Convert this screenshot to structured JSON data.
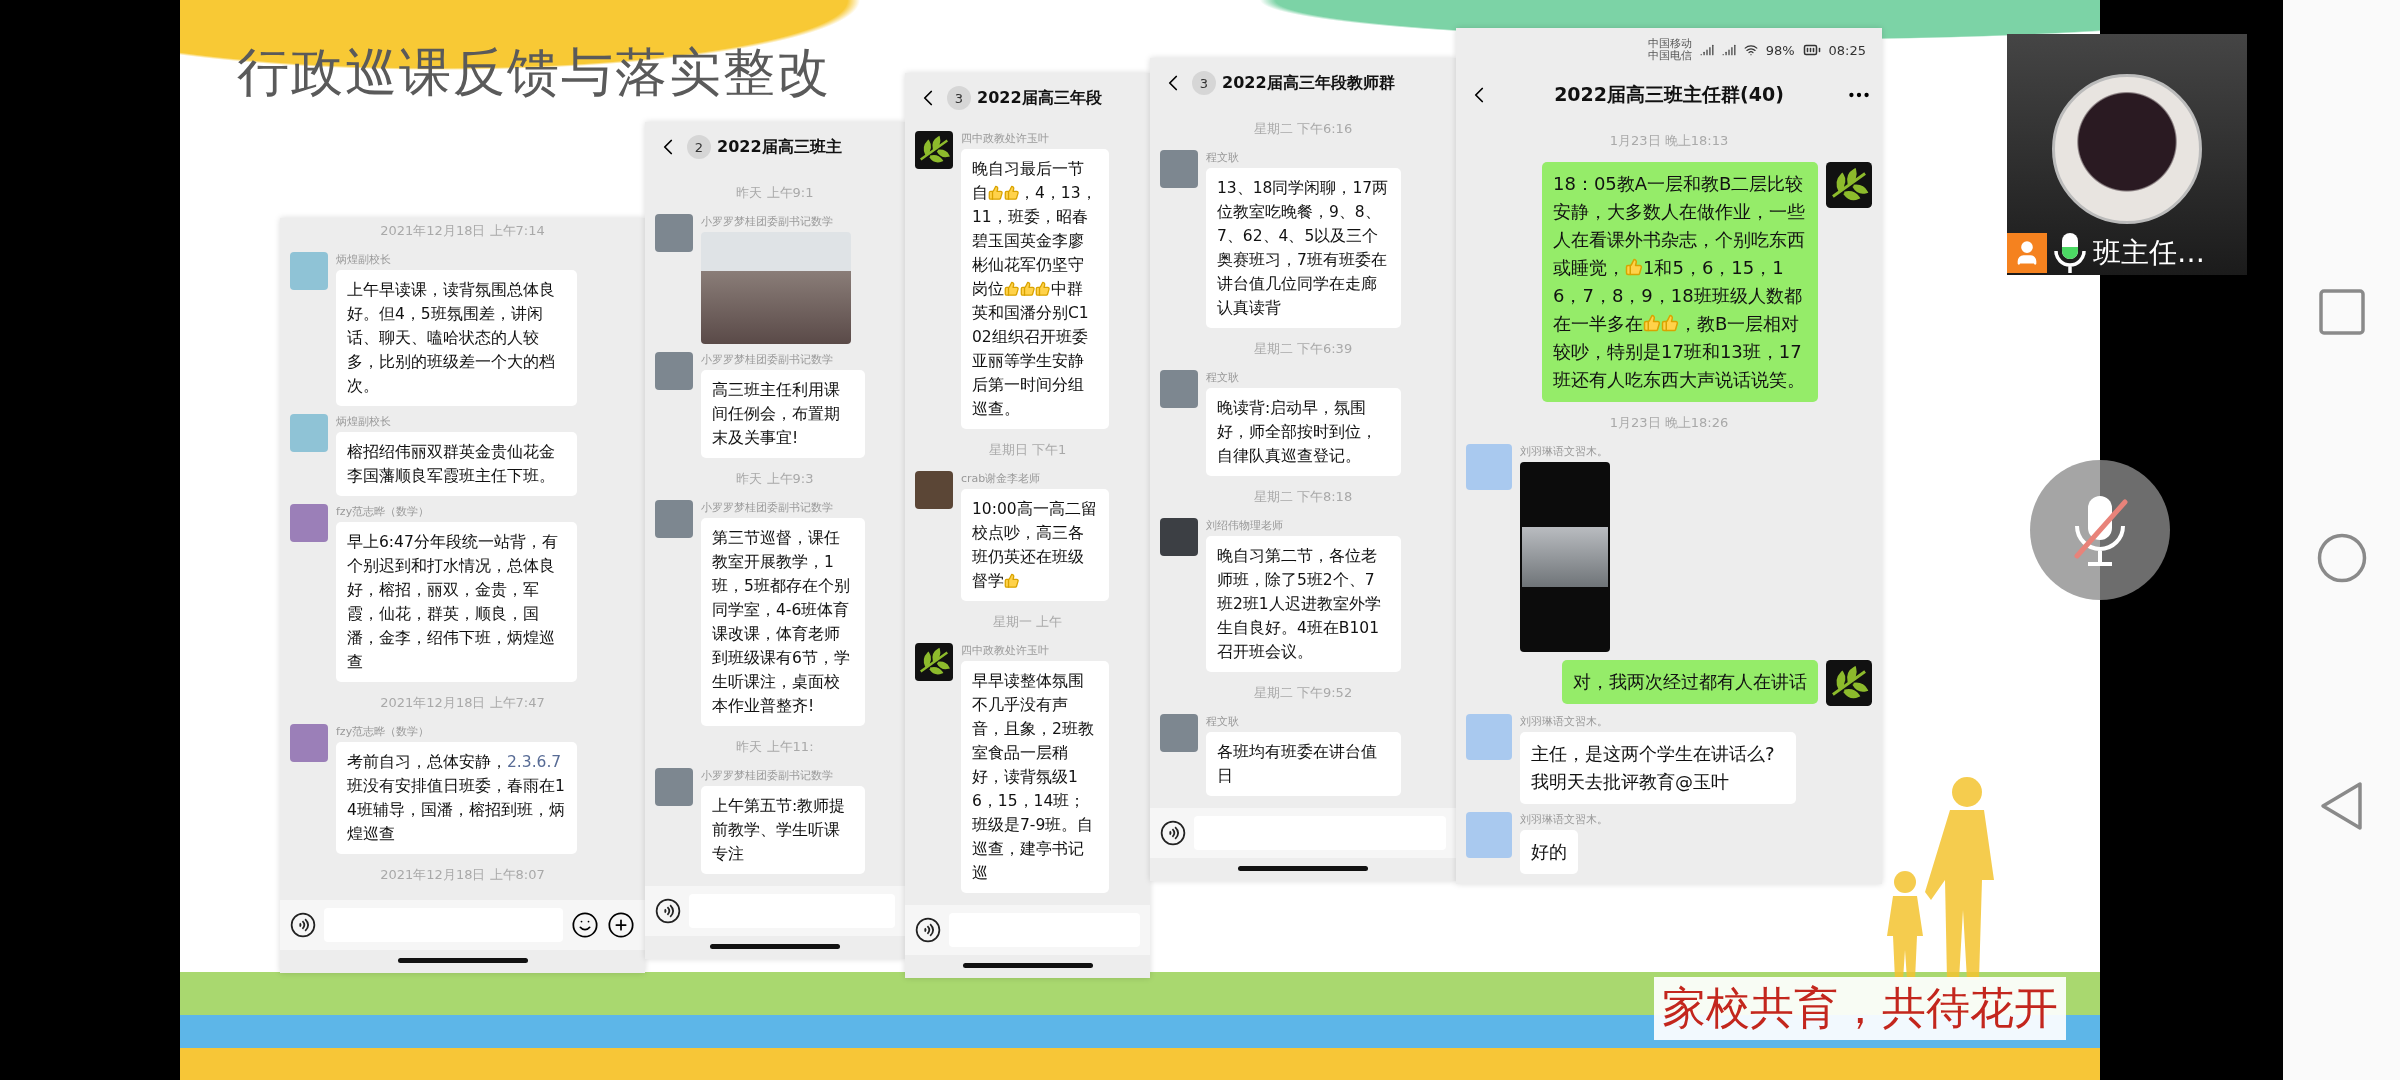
{
  "slide": {
    "title": "行政巡课反馈与落实整改",
    "motto": "家校共育，共待花开"
  },
  "panels": [
    {
      "input_bar": {
        "full": true
      },
      "items": [
        {
          "kind": "time",
          "text": "2021年12月18日 上午7:14"
        },
        {
          "kind": "message",
          "sender": "炳煌副校长",
          "avatar": {
            "kind": "landscape"
          },
          "self": false,
          "parts": [
            {
              "kind": "text",
              "text": "上午早读课，读背氛围总体良好。但4，5班氛围差，讲闲话、聊天、嗑哈状态的人较多，比别的班级差一个大的档次。"
            }
          ]
        },
        {
          "kind": "message",
          "sender": "炳煌副校长",
          "avatar": {
            "kind": "landscape"
          },
          "self": false,
          "parts": [
            {
              "kind": "text",
              "text": "榕招绍伟丽双群英金贵仙花金李国藩顺良军霞班主任下班。"
            }
          ]
        },
        {
          "kind": "message",
          "sender": "fzy范志晔（数学）",
          "avatar": {
            "kind": "cartoon"
          },
          "self": false,
          "parts": [
            {
              "kind": "text",
              "text": "早上6:47分年段统一站背，有个别迟到和打水情况，总体良好，榕招，丽双，金贵，军霞，仙花，群英，顺良，国潘，金李，绍伟下班，炳煌巡查"
            }
          ]
        },
        {
          "kind": "time",
          "text": "2021年12月18日 上午7:47"
        },
        {
          "kind": "message",
          "sender": "fzy范志晔（数学）",
          "avatar": {
            "kind": "cartoon"
          },
          "self": false,
          "parts": [
            {
              "kind": "text",
              "text": "考前自习，总体安静，"
            },
            {
              "kind": "link",
              "text": "2.3.6.7"
            },
            {
              "kind": "text",
              "text": "班没有安排值日班委，春雨在14班辅导，国潘，榕招到班，炳煌巡查"
            }
          ]
        },
        {
          "kind": "time",
          "text": "2021年12月18日 上午8:07"
        }
      ]
    },
    {
      "header": {
        "title": "2022届高三班主",
        "badge": "2",
        "more_menu": false
      },
      "input_bar": {
        "full": false
      },
      "items": [
        {
          "kind": "time",
          "text": "昨天 上午9:1"
        },
        {
          "kind": "photo",
          "sender": "小罗罗梦桂团委副书记数学",
          "avatar": {
            "kind": "portrait"
          }
        },
        {
          "kind": "message",
          "sender": "小罗罗梦桂团委副书记数学",
          "avatar": {
            "kind": "portrait"
          },
          "self": false,
          "parts": [
            {
              "kind": "text",
              "text": "高三班主任利用课间任例会，布置期末及关事宜!"
            }
          ]
        },
        {
          "kind": "time",
          "text": "昨天 上午9:3"
        },
        {
          "kind": "message",
          "sender": "小罗罗梦桂团委副书记数学",
          "avatar": {
            "kind": "portrait"
          },
          "self": false,
          "parts": [
            {
              "kind": "text",
              "text": "第三节巡督，课任教室开展教学，1班，5班都存在个别同学室，4-6班体育课改课，体育老师到班级课有6节，学生听课注，桌面校本作业普整齐!"
            }
          ]
        },
        {
          "kind": "time",
          "text": "昨天 上午11:"
        },
        {
          "kind": "message",
          "sender": "小罗罗梦桂团委副书记数学",
          "avatar": {
            "kind": "portrait"
          },
          "self": false,
          "parts": [
            {
              "kind": "text",
              "text": "上午第五节:教师提前教学、学生听课专注"
            }
          ]
        }
      ]
    },
    {
      "header": {
        "title": "2022届高三年段",
        "badge": "3",
        "more_menu": false
      },
      "input_bar": {
        "full": false
      },
      "items": [
        {
          "kind": "message",
          "sender": "四中政教处许玉叶",
          "avatar": {
            "kind": "leaf"
          },
          "self": false,
          "parts": [
            {
              "kind": "text",
              "text": "晚自习最后一节自"
            },
            {
              "kind": "thumb"
            },
            {
              "kind": "thumb"
            },
            {
              "kind": "text",
              "text": "，4，13，11，班委，昭春碧玉国英金李廖彬仙花军仍坚守岗位"
            },
            {
              "kind": "thumb"
            },
            {
              "kind": "thumb"
            },
            {
              "kind": "thumb"
            },
            {
              "kind": "text",
              "text": "中群英和国潘分别C102组织召开班委亚丽等学生安静后第一时间分组巡查。"
            }
          ]
        },
        {
          "kind": "time",
          "text": "星期日 下午1"
        },
        {
          "kind": "message",
          "sender": "crab谢金李老师",
          "avatar": {
            "kind": "tree"
          },
          "self": false,
          "parts": [
            {
              "kind": "text",
              "text": "10:00高一高二留校点吵，高三各班仍英还在班级督学"
            },
            {
              "kind": "thumb"
            }
          ]
        },
        {
          "kind": "time",
          "text": "星期一 上午"
        },
        {
          "kind": "message",
          "sender": "四中政教处许玉叶",
          "avatar": {
            "kind": "leaf"
          },
          "self": false,
          "parts": [
            {
              "kind": "text",
              "text": "早早读整体氛围不几乎没有声音，且象，2班教室食品一层稍好，读背氛级16，15，14班；班级是7-9班。自巡查，建亭书记巡"
            }
          ]
        }
      ]
    },
    {
      "header": {
        "title": "2022届高三年段教师群",
        "badge": "3",
        "more_menu": false
      },
      "input_bar": {
        "full": false
      },
      "items": [
        {
          "kind": "time",
          "text": "星期二 下午6:16"
        },
        {
          "kind": "message",
          "sender": "程文耿",
          "avatar": {
            "kind": "portrait"
          },
          "self": false,
          "parts": [
            {
              "kind": "text",
              "text": "13、18同学闲聊，17两位教室吃晚餐，9、8、7、62、4、5以及三个奥赛班习，7班有班委在讲台值几位同学在走廊认真读背"
            }
          ]
        },
        {
          "kind": "time",
          "text": "星期二 下午6:39"
        },
        {
          "kind": "message",
          "sender": "程文耿",
          "avatar": {
            "kind": "portrait"
          },
          "self": false,
          "parts": [
            {
              "kind": "text",
              "text": "晚读背:启动早，氛围好，师全部按时到位，自律队真巡查登记。"
            }
          ]
        },
        {
          "kind": "time",
          "text": "星期二 下午8:18"
        },
        {
          "kind": "message",
          "sender": "刘绍伟物理老师",
          "avatar": {
            "kind": "dark"
          },
          "self": false,
          "parts": [
            {
              "kind": "text",
              "text": "晚自习第二节，各位老师班，除了5班2个、7班2班1人迟进教室外学生自良好。4班在B101召开班会议。"
            }
          ]
        },
        {
          "kind": "time",
          "text": "星期二 下午9:52"
        },
        {
          "kind": "message",
          "sender": "程文耿",
          "avatar": {
            "kind": "portrait"
          },
          "self": false,
          "parts": [
            {
              "kind": "text",
              "text": "各班均有班委在讲台值日"
            }
          ]
        }
      ]
    },
    {
      "status_bar": {
        "carrier_1": "中国移动",
        "carrier_2": "中国电信",
        "battery": "98%",
        "time": "08:25"
      },
      "header": {
        "title": "2022届高三班主任群(40)",
        "more_menu": true
      },
      "items": [
        {
          "kind": "time",
          "text": "1月23日 晚上18:13"
        },
        {
          "kind": "message",
          "avatar": {
            "kind": "leaf"
          },
          "self": true,
          "parts": [
            {
              "kind": "text",
              "text": "18：05教A一层和教B二层比较安静，大多数人在做作业，一些人在看课外书杂志，个别吃东西或睡觉，"
            },
            {
              "kind": "thumb"
            },
            {
              "kind": "text",
              "text": "1和5，6，15，16，7，8，9，18班班级人数都在一半多在"
            },
            {
              "kind": "thumb"
            },
            {
              "kind": "thumb"
            },
            {
              "kind": "text",
              "text": "，教B一层相对较吵，特别是17班和13班，17班还有人吃东西大声说话说笑。"
            }
          ]
        },
        {
          "kind": "time",
          "text": "1月23日 晚上18:26"
        },
        {
          "kind": "video",
          "sender": "刘羽琳语文習木。",
          "avatar": {
            "kind": "duck"
          }
        },
        {
          "kind": "message",
          "avatar": {
            "kind": "leaf"
          },
          "self": true,
          "parts": [
            {
              "kind": "text",
              "text": "对，我两次经过都有人在讲话"
            }
          ]
        },
        {
          "kind": "message",
          "sender": "刘羽琳语文習木。",
          "avatar": {
            "kind": "duck"
          },
          "self": false,
          "parts": [
            {
              "kind": "text",
              "text": "主任，是这两个学生在讲话么?我明天去批评教育@玉叶"
            }
          ]
        },
        {
          "kind": "message",
          "sender": "刘羽琳语文習木。",
          "avatar": {
            "kind": "duck"
          },
          "self": false,
          "parts": [
            {
              "kind": "text",
              "text": "好的"
            }
          ]
        }
      ]
    }
  ],
  "video_tile": {
    "name": "班主任…"
  },
  "mute_button": {
    "muted": true
  }
}
